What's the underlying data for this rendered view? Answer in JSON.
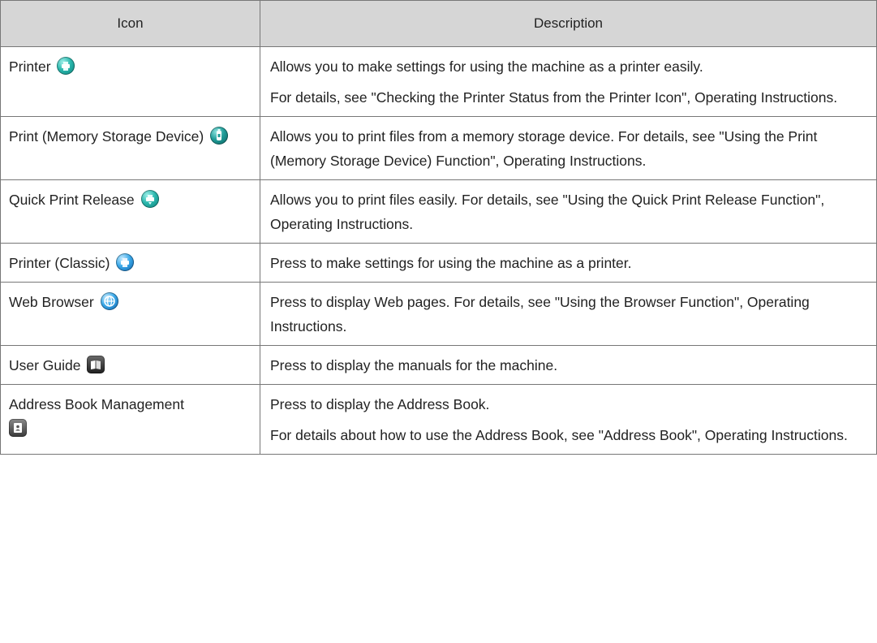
{
  "table": {
    "header": {
      "icon": "Icon",
      "description": "Description"
    },
    "rows": [
      {
        "name": "Printer",
        "icon": "printer-icon",
        "desc": [
          "Allows you to make settings for using the machine as a printer easily.",
          "For details, see \"Checking the Printer Status from the Printer Icon\", Operating Instructions."
        ]
      },
      {
        "name": "Print (Memory Storage Device)",
        "icon": "memory-storage-icon",
        "desc": [
          "Allows you to print files from a memory storage device. For details, see \"Using the Print (Memory Storage Device) Function\", Operating Instructions."
        ]
      },
      {
        "name": "Quick Print Release",
        "icon": "quick-print-release-icon",
        "desc": [
          "Allows you to print files easily. For details, see \"Using the Quick Print Release Function\", Operating Instructions."
        ]
      },
      {
        "name": "Printer (Classic)",
        "icon": "printer-classic-icon",
        "desc": [
          "Press to make settings for using the machine as a printer."
        ]
      },
      {
        "name": "Web Browser",
        "icon": "web-browser-icon",
        "desc": [
          "Press to display Web pages. For details, see \"Using the Browser Function\", Operating Instructions."
        ]
      },
      {
        "name": "User Guide",
        "icon": "user-guide-icon",
        "desc": [
          "Press to display the manuals for the machine."
        ]
      },
      {
        "name": "Address Book Management",
        "icon": "address-book-icon",
        "desc": [
          "Press to display the Address Book.",
          "For details about how to use the Address Book, see \"Address Book\", Operating Instructions."
        ]
      }
    ]
  }
}
